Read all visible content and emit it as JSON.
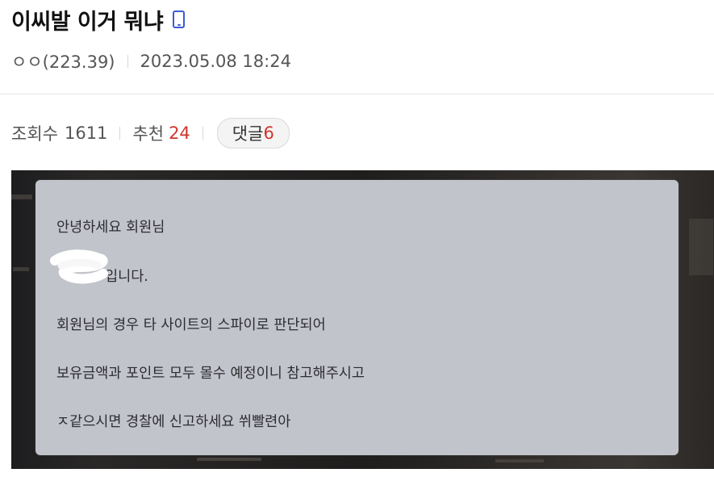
{
  "post": {
    "title": "이씨발 이거 뭐냐",
    "author": "ㅇㅇ(223.39)",
    "date": "2023.05.08 18:24"
  },
  "stats": {
    "views_label": "조회수",
    "views_value": "1611",
    "recommend_label": "추천",
    "recommend_value": "24",
    "comment_label": "댓글",
    "comment_value": "6"
  },
  "notice": {
    "line1": "안녕하세요 회원님",
    "line2": "입니다.",
    "line3": "회원님의 경우 타 사이트의 스파이로 판단되어",
    "line4": "보유금액과 포인트 모두 몰수 예정이니 참고해주시고",
    "line5": "ㅈ같으시면 경찰에 신고하세요 쒸빨련아"
  },
  "icons": {
    "title_icon": "mobile-phone-icon"
  },
  "colors": {
    "accent_blue": "#3b5bd6",
    "recommend_red": "#d0342c",
    "notice_bg": "#c2c4cb"
  }
}
